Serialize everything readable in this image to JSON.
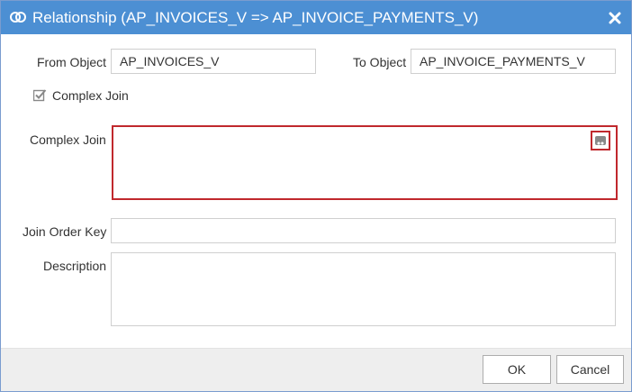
{
  "dialog": {
    "title": "Relationship (AP_INVOICES_V => AP_INVOICE_PAYMENTS_V)",
    "title_icon": "link-circles-icon",
    "close_icon": "close-icon",
    "accent_color": "#4c8fd3"
  },
  "form": {
    "from_object_label": "From Object",
    "from_object_value": "AP_INVOICES_V",
    "to_object_label": "To Object",
    "to_object_value": "AP_INVOICE_PAYMENTS_V",
    "complex_join_checkbox_label": "Complex Join",
    "complex_join_checked": true,
    "complex_join_label": "Complex Join",
    "complex_join_value": "",
    "expression_button_icon": "expression-editor-icon",
    "join_order_key_label": "Join Order Key",
    "join_order_key_value": "",
    "description_label": "Description",
    "description_value": "",
    "highlight_color": "#c0282d"
  },
  "footer": {
    "ok_label": "OK",
    "cancel_label": "Cancel"
  }
}
